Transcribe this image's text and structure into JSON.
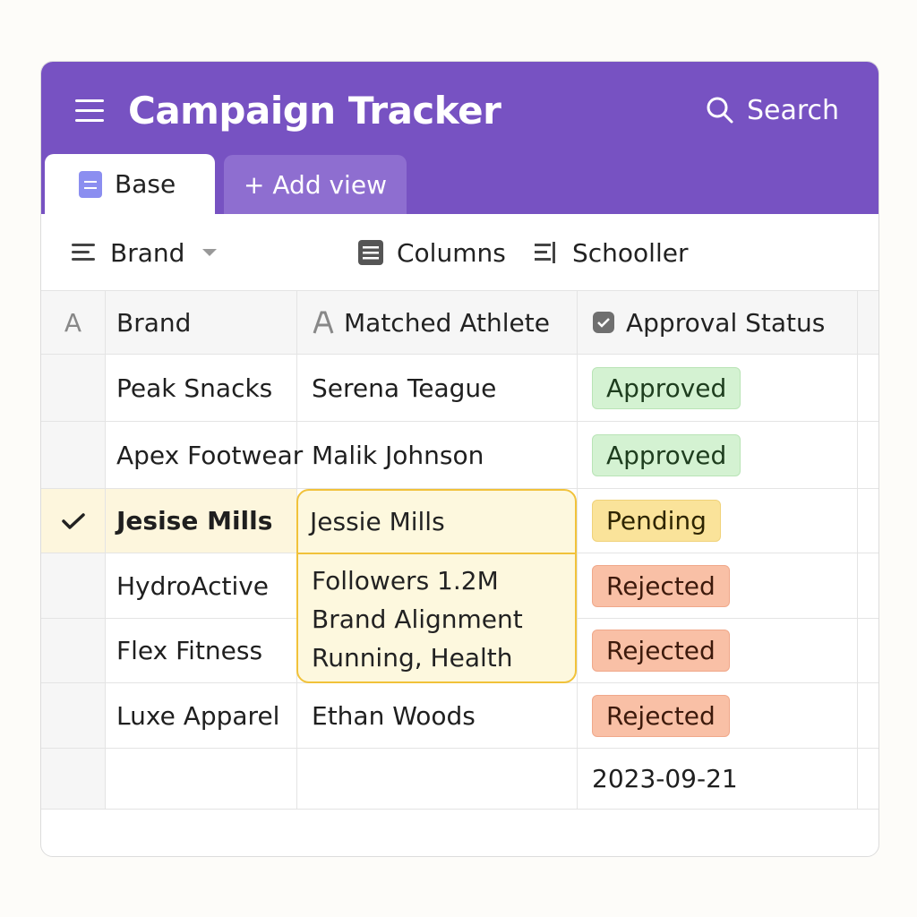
{
  "app": {
    "title": "Campaign Tracker",
    "search_label": "Search"
  },
  "tabs": [
    {
      "label": "Base",
      "active": true
    },
    {
      "label": "+ Add view",
      "active": false
    }
  ],
  "toolbar": {
    "group_label": "Brand",
    "columns_label": "Columns",
    "schedule_label": "Schooller"
  },
  "columns": {
    "row_marker": "A",
    "brand": "Brand",
    "athlete": "Matched Athlete",
    "status": "Approval Status"
  },
  "rows": [
    {
      "brand": "Peak Snacks",
      "athlete": "Serena Teague",
      "status": "Approved",
      "status_type": "approved"
    },
    {
      "brand": "Apex Footwear",
      "athlete": "Malik Johnson",
      "status": "Approved",
      "status_type": "approved"
    },
    {
      "brand": "Jesise Mills",
      "athlete": "",
      "status": "Pending",
      "status_type": "pending",
      "selected": true
    },
    {
      "brand": "HydroActive",
      "athlete": "",
      "status": "Rejected",
      "status_type": "rejected"
    },
    {
      "brand": "Flex Fitness",
      "athlete": "",
      "status": "Rejected",
      "status_type": "rejected"
    },
    {
      "brand": "Luxe Apparel",
      "athlete": "Ethan Woods",
      "status": "Rejected",
      "status_type": "rejected"
    },
    {
      "brand": "",
      "athlete": "",
      "status": "2023-09-21",
      "status_type": "date"
    }
  ],
  "popup": {
    "athlete": "Jessie Mills",
    "followers": "Followers  1.2M",
    "alignment_label": "Brand Alignment",
    "alignment_value": "Running, Health"
  },
  "colors": {
    "header": "#7752c2",
    "add_tab": "#8e6ed0",
    "approved": "#d4f2d2",
    "pending": "#fae39a",
    "rejected": "#f9c0a6",
    "selected_row": "#fdf6dd",
    "popup_border": "#f1c23a"
  }
}
